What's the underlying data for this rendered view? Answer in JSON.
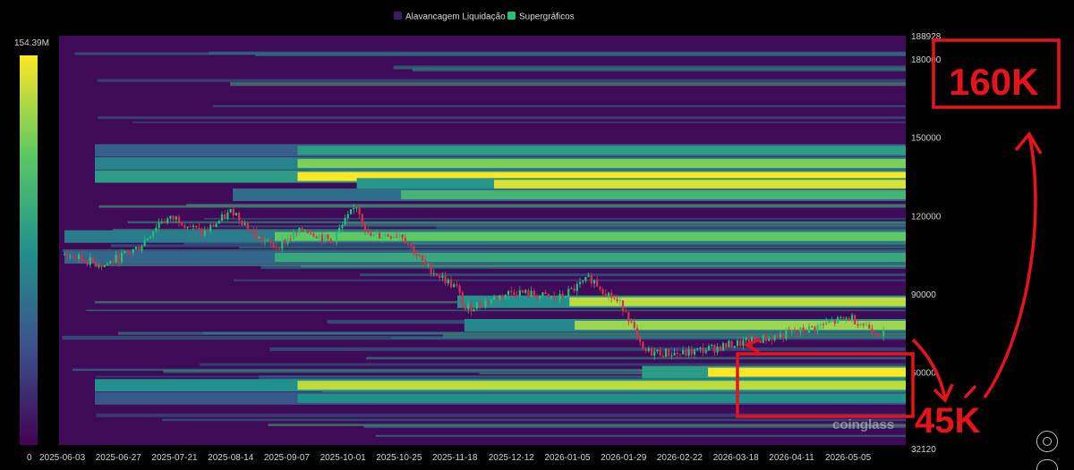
{
  "legend": [
    {
      "label": "Alavancagem Liquidação",
      "color": "#3d1a66"
    },
    {
      "label": "Supergráficos",
      "color": "#22c178"
    }
  ],
  "colorbar": {
    "max_label": "154.39M",
    "min_label": "0"
  },
  "watermark": "coinglass",
  "annotations": {
    "box_top_text": "160K",
    "arrow_text": "45K"
  },
  "chart_data": {
    "type": "heatmap",
    "title": "",
    "series": [
      {
        "name": "Alavancagem Liquidação",
        "type": "heatmap"
      },
      {
        "name": "Supergráficos",
        "type": "candlestick"
      }
    ],
    "x_ticks": [
      "2025-06-03",
      "2025-06-27",
      "2025-07-21",
      "2025-08-14",
      "2025-09-07",
      "2025-10-01",
      "2025-10-25",
      "2025-11-18",
      "2025-12-12",
      "2026-01-05",
      "2026-01-29",
      "2026-02-22",
      "2026-03-18",
      "2026-04-11",
      "2026-05-05"
    ],
    "y_ticks": [
      "188928",
      "180000",
      "150000",
      "120000",
      "90000",
      "60000",
      "32120"
    ],
    "y_tick_values": [
      188928,
      180000,
      150000,
      120000,
      90000,
      60000,
      32120
    ],
    "ylim": [
      32120,
      188928
    ],
    "colorbar_range": [
      0,
      154390000
    ],
    "price_path": [
      {
        "date": "2025-06-03",
        "close": 105000
      },
      {
        "date": "2025-06-20",
        "close": 101000
      },
      {
        "date": "2025-07-05",
        "close": 108000
      },
      {
        "date": "2025-07-14",
        "close": 118000
      },
      {
        "date": "2025-07-21",
        "close": 119000
      },
      {
        "date": "2025-08-01",
        "close": 113000
      },
      {
        "date": "2025-08-14",
        "close": 122000
      },
      {
        "date": "2025-08-24",
        "close": 112000
      },
      {
        "date": "2025-09-01",
        "close": 108000
      },
      {
        "date": "2025-09-14",
        "close": 115000
      },
      {
        "date": "2025-09-25",
        "close": 110000
      },
      {
        "date": "2025-10-06",
        "close": 124000
      },
      {
        "date": "2025-10-11",
        "close": 112000
      },
      {
        "date": "2025-10-25",
        "close": 113000
      },
      {
        "date": "2025-11-04",
        "close": 101000
      },
      {
        "date": "2025-11-18",
        "close": 92000
      },
      {
        "date": "2025-11-21",
        "close": 84000
      },
      {
        "date": "2025-12-12",
        "close": 91000
      },
      {
        "date": "2025-12-31",
        "close": 88000
      },
      {
        "date": "2026-01-14",
        "close": 96000
      },
      {
        "date": "2026-01-29",
        "close": 84000
      },
      {
        "date": "2026-02-05",
        "close": 68000
      },
      {
        "date": "2026-02-22",
        "close": 67000
      },
      {
        "date": "2026-03-18",
        "close": 71000
      },
      {
        "date": "2026-04-11",
        "close": 75000
      },
      {
        "date": "2026-05-05",
        "close": 81000
      },
      {
        "date": "2026-05-20",
        "close": 74000
      }
    ],
    "liquidation_bands": [
      {
        "price": 135000,
        "intensity": 1.0
      },
      {
        "price": 132000,
        "intensity": 0.95
      },
      {
        "price": 140000,
        "intensity": 0.8
      },
      {
        "price": 128000,
        "intensity": 0.65
      },
      {
        "price": 145000,
        "intensity": 0.55
      },
      {
        "price": 112000,
        "intensity": 0.75
      },
      {
        "price": 104000,
        "intensity": 0.6
      },
      {
        "price": 87000,
        "intensity": 0.9
      },
      {
        "price": 78000,
        "intensity": 0.85
      },
      {
        "price": 60000,
        "intensity": 1.0
      },
      {
        "price": 55000,
        "intensity": 0.9
      },
      {
        "price": 50000,
        "intensity": 0.5
      }
    ]
  }
}
